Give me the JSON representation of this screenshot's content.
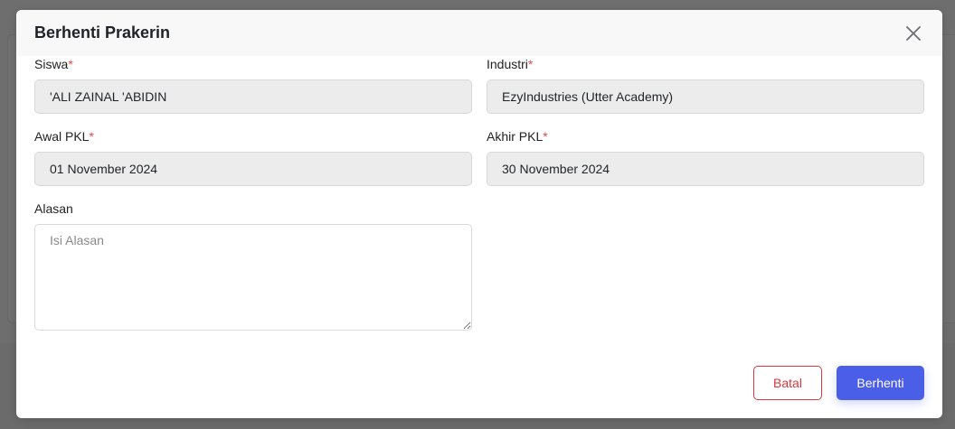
{
  "modal": {
    "title": "Berhenti Prakerin",
    "close_icon": "close-icon"
  },
  "form": {
    "siswa": {
      "label": "Siswa",
      "required_mark": "*",
      "value": "'ALI ZAINAL 'ABIDIN"
    },
    "industri": {
      "label": "Industri",
      "required_mark": "*",
      "value": "EzyIndustries (Utter Academy)"
    },
    "awal_pkl": {
      "label": "Awal PKL",
      "required_mark": "*",
      "value": "01 November 2024"
    },
    "akhir_pkl": {
      "label": "Akhir PKL",
      "required_mark": "*",
      "value": "30 November 2024"
    },
    "alasan": {
      "label": "Alasan",
      "placeholder": "Isi Alasan",
      "value": ""
    }
  },
  "actions": {
    "cancel_label": "Batal",
    "submit_label": "Berhenti"
  },
  "colors": {
    "accent": "#4a5ee8",
    "danger": "#d9363e",
    "required": "#e5484d",
    "readonly_bg": "#ececec"
  }
}
